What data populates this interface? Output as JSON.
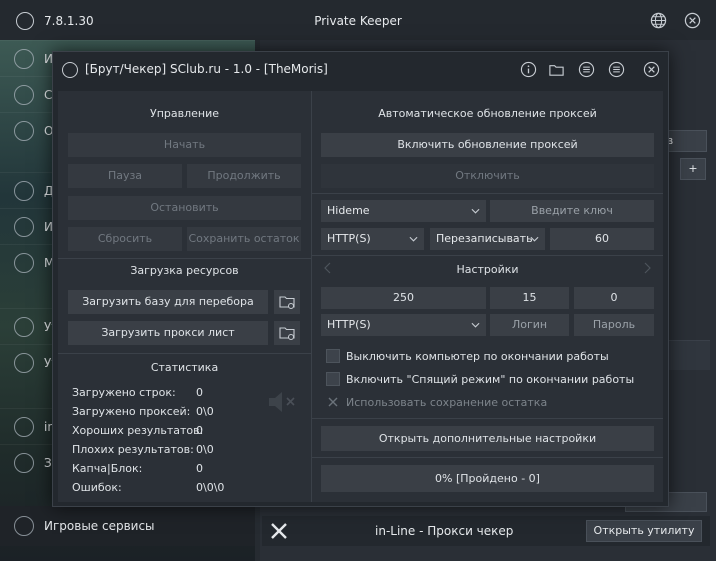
{
  "background_app": {
    "version": "7.8.1.30",
    "title": "Private Keeper",
    "sidebar_items": [
      {
        "label": "И",
        "icon": "user-icon"
      },
      {
        "label": "С",
        "icon": "sync-icon"
      },
      {
        "label": "О",
        "icon": "gear-icon"
      },
      {
        "label": "Д",
        "icon": "list-icon"
      },
      {
        "label": "И",
        "icon": "window-icon"
      },
      {
        "label": "М",
        "icon": "cloud-icon"
      },
      {
        "label": "Ут",
        "icon": "search-icon"
      },
      {
        "label": "Ут",
        "icon": "history-icon"
      },
      {
        "label": "in",
        "icon": "gear-icon"
      },
      {
        "label": "За",
        "icon": "gear-icon"
      }
    ],
    "bottom_side_label": "Игровые сервисы",
    "top_right_field": "ов",
    "bottom_tool_label": "in-Line - Прокси чекер",
    "open_utility_label": "Открыть утилиту",
    "open_utility_partial": "рыть утилиту"
  },
  "dialog": {
    "title": "[Брут/Чекер] SClub.ru - 1.0 - [TheMoris]",
    "control": {
      "title": "Управление",
      "start": "Начать",
      "pause": "Пауза",
      "continue": "Продолжить",
      "stop": "Остановить",
      "reset": "Сбросить",
      "save_remainder": "Сохранить остаток"
    },
    "resources": {
      "title": "Загрузка ресурсов",
      "load_base": "Загрузить базу для перебора",
      "load_proxy": "Загрузить прокси лист"
    },
    "stats": {
      "title": "Статистика",
      "rows": [
        {
          "label": "Загружено строк:",
          "value": "0"
        },
        {
          "label": "Загружено проксей:",
          "value": "0\\0"
        },
        {
          "label": "Хороших результатов:",
          "value": "0"
        },
        {
          "label": "Плохих результатов:",
          "value": "0\\0"
        },
        {
          "label": "Капча|Блок:",
          "value": "0"
        },
        {
          "label": "Ошибок:",
          "value": "0\\0\\0"
        }
      ]
    },
    "proxy_update": {
      "title": "Автоматическое обновление проксей",
      "enable": "Включить обновление проксей",
      "disable": "Отключить",
      "provider": "Hideme",
      "key_placeholder": "Введите ключ",
      "protocol": "HTTP(S)",
      "mode": "Перезаписывать",
      "interval": "60"
    },
    "settings": {
      "title": "Настройки",
      "threads": "250",
      "timeout": "15",
      "retries": "0",
      "protocol": "HTTP(S)",
      "login_placeholder": "Логин",
      "password_placeholder": "Пароль",
      "shutdown_label": "Выключить компьютер по окончании работы",
      "sleep_label": "Включить \"Спящий режим\" по окончании работы",
      "save_remainder_label": "Использовать сохранение остатка",
      "advanced": "Открыть дополнительные настройки"
    },
    "progress_label": "0% [Пройдено - 0]"
  }
}
